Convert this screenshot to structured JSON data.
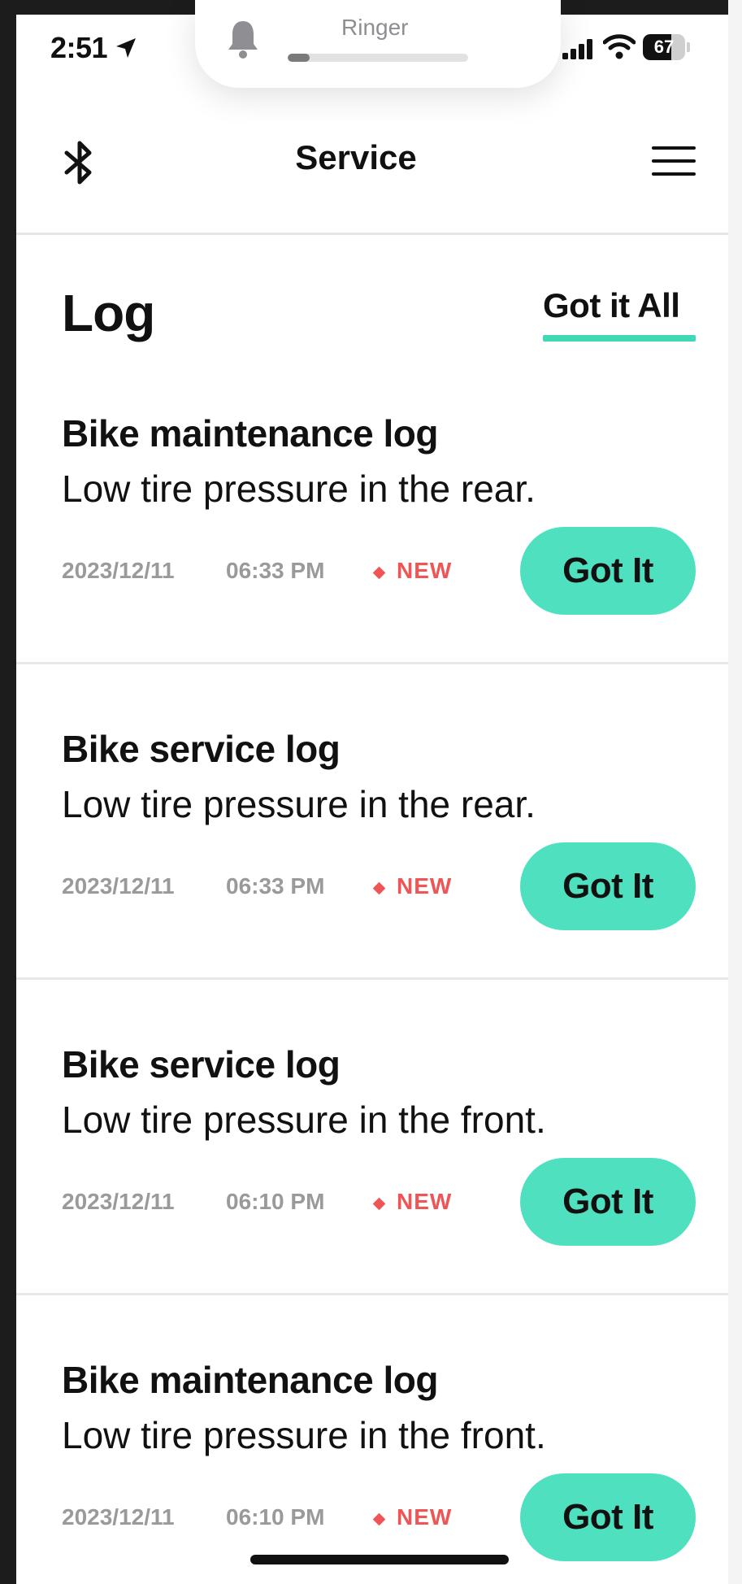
{
  "status_bar": {
    "time": "2:51",
    "battery": "67",
    "battery_level": 0.67
  },
  "ringer": {
    "label": "Ringer",
    "level": 0.12
  },
  "nav": {
    "title": "Service"
  },
  "log": {
    "title": "Log",
    "got_all_label": "Got it All"
  },
  "items": [
    {
      "title": "Bike maintenance log",
      "message": "Low tire pressure in the rear.",
      "date": "2023/12/11",
      "time": "06:33 PM",
      "badge": "NEW",
      "button": "Got It"
    },
    {
      "title": "Bike service log",
      "message": "Low tire pressure in the rear.",
      "date": "2023/12/11",
      "time": "06:33 PM",
      "badge": "NEW",
      "button": "Got It"
    },
    {
      "title": "Bike service log",
      "message": "Low tire pressure in the front.",
      "date": "2023/12/11",
      "time": "06:10 PM",
      "badge": "NEW",
      "button": "Got It"
    },
    {
      "title": "Bike maintenance log",
      "message": "Low tire pressure in the front.",
      "date": "2023/12/11",
      "time": "06:10 PM",
      "badge": "NEW",
      "button": "Got It"
    }
  ],
  "colors": {
    "accent": "#4fe1bf",
    "new_badge": "#f05454"
  },
  "icons": {
    "location": "location-arrow-icon",
    "bell": "bell-icon",
    "signal": "cellular-signal-icon",
    "wifi": "wifi-icon",
    "bluetooth": "bluetooth-icon",
    "menu": "hamburger-menu-icon"
  }
}
